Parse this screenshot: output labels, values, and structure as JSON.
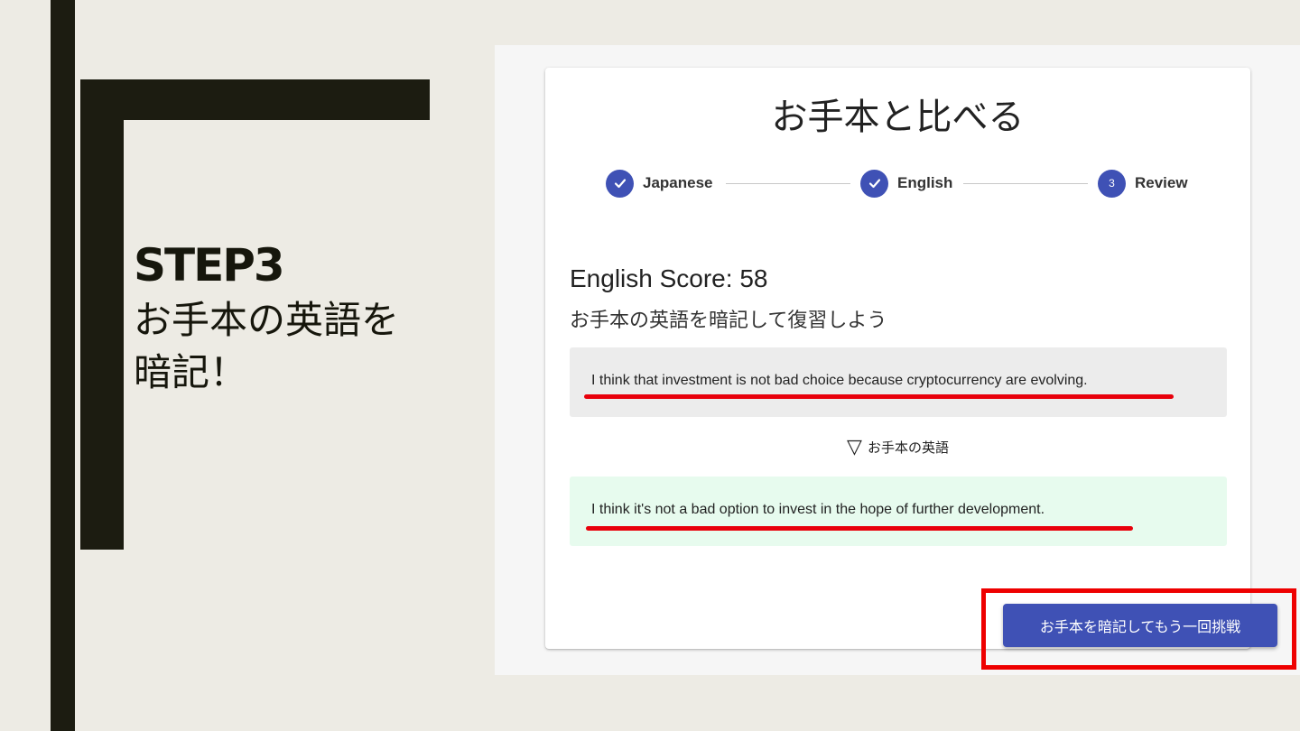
{
  "slide": {
    "heading": "STEP3",
    "description_line1": "お手本の英語を",
    "description_line2": "暗記！"
  },
  "app": {
    "title": "お手本と比べる",
    "stepper": {
      "steps": [
        {
          "label": "Japanese",
          "state": "completed",
          "icon": "check-icon"
        },
        {
          "label": "English",
          "state": "completed",
          "icon": "check-icon"
        },
        {
          "label": "Review",
          "state": "active",
          "number": "3"
        }
      ]
    },
    "score": "English Score: 58",
    "instruction": "お手本の英語を暗記して復習しよう",
    "user_answer": "I think that investment is not bad choice because cryptocurrency are evolving.",
    "model_toggle": {
      "icon": "triangle-down-icon",
      "symbol": "▽",
      "label": "お手本の英語"
    },
    "model_answer": "I think it's not a bad option to invest in the hope of further development.",
    "retry_button": "お手本を暗記してもう一回挑戦"
  },
  "colors": {
    "primary": "#3f51b5",
    "highlight": "#ee0000",
    "slide_background": "#edebe4",
    "slide_dark": "#1c1c11",
    "model_box_bg": "#e7fbee",
    "answer_box_bg": "#ececec"
  }
}
